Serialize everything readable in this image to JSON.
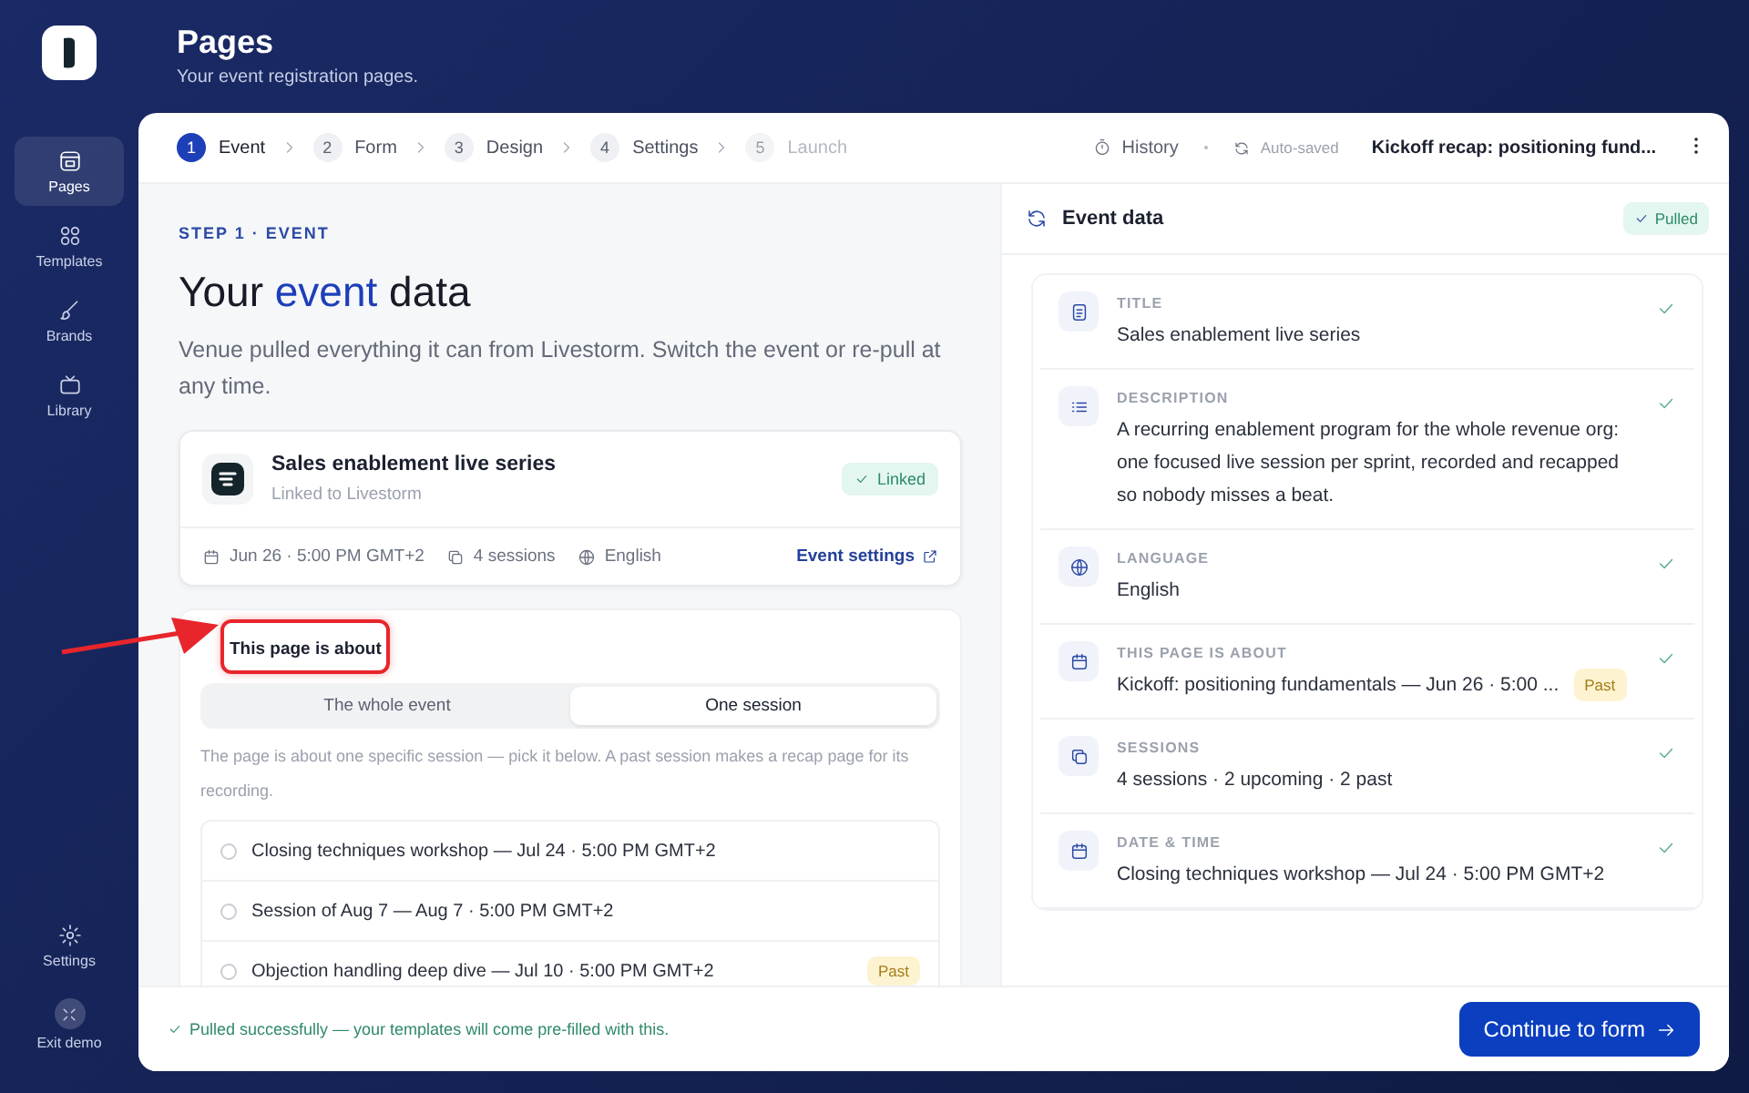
{
  "sidebar": {
    "items": [
      {
        "label": "Pages",
        "kind": "pages",
        "selected": true
      },
      {
        "label": "Templates",
        "kind": "templates",
        "selected": false
      },
      {
        "label": "Brands",
        "kind": "brands",
        "selected": false
      },
      {
        "label": "Library",
        "kind": "library",
        "selected": false
      }
    ],
    "bottom_items": [
      {
        "label": "Settings",
        "kind": "settings"
      },
      {
        "label": "Exit demo",
        "kind": "exit"
      }
    ]
  },
  "header": {
    "title": "Pages",
    "subtitle": "Your event registration pages."
  },
  "stepper": {
    "steps": [
      {
        "number": "1",
        "label": "Event",
        "selected": true,
        "disabled": false
      },
      {
        "number": "2",
        "label": "Form",
        "selected": false,
        "disabled": false
      },
      {
        "number": "3",
        "label": "Design",
        "selected": false,
        "disabled": false
      },
      {
        "number": "4",
        "label": "Settings",
        "selected": false,
        "disabled": false
      },
      {
        "number": "5",
        "label": "Launch",
        "selected": false,
        "disabled": true
      }
    ],
    "history": "History",
    "autosave": "Auto-saved",
    "page_title": "Kickoff recap: positioning fund..."
  },
  "event": {
    "step_label": "STEP 1 · EVENT",
    "heading": [
      {
        "text": "Your",
        "highlight": false
      },
      {
        "text": "event",
        "highlight": true
      },
      {
        "text": "data",
        "highlight": false
      }
    ],
    "intro": "Venue pulled everything it can from Livestorm. Switch the event or re-pull at any time.",
    "card": {
      "title": "Sales enablement live series",
      "subtitle": "Linked to Livestorm",
      "badge": "Linked",
      "meta": [
        {
          "kind": "date",
          "text": "Jun 26 · 5:00 PM GMT+2"
        },
        {
          "kind": "sessions",
          "text": "4 sessions"
        },
        {
          "kind": "language",
          "text": "English"
        }
      ],
      "link": "Event settings"
    },
    "about": {
      "label": "This page is about",
      "options": [
        {
          "label": "The whole event",
          "selected": false
        },
        {
          "label": "One session",
          "selected": true
        }
      ],
      "hint": "The page is about one specific session — pick it below. A past session makes a recap page for its recording.",
      "sessions": [
        {
          "label": "Closing techniques workshop — Jul 24 · 5:00 PM GMT+2",
          "selected": false
        },
        {
          "label": "Session of Aug 7 — Aug 7 · 5:00 PM GMT+2",
          "selected": false
        },
        {
          "label": "Objection handling deep dive — Jul 10 · 5:00 PM GMT+2",
          "selected": false,
          "badge": "Past"
        }
      ]
    }
  },
  "data_panel": {
    "title": "Event data",
    "badge": "Pulled",
    "fields": [
      {
        "kind": "title",
        "label": "TITLE",
        "value": "Sales enablement live series",
        "verified": true
      },
      {
        "kind": "description",
        "label": "DESCRIPTION",
        "value": "A recurring enablement program for the whole revenue org: one focused live session per sprint, recorded and recapped so nobody misses a beat.",
        "verified": true
      },
      {
        "kind": "language",
        "label": "LANGUAGE",
        "value": "English",
        "verified": true
      },
      {
        "kind": "about",
        "label": "THIS PAGE IS ABOUT",
        "value": "Kickoff: positioning fundamentals — Jun 26 · 5:00 ...",
        "badge": "Past",
        "verified": true
      },
      {
        "kind": "sessions",
        "label": "SESSIONS",
        "value": "4 sessions · 2 upcoming · 2 past",
        "verified": true
      },
      {
        "kind": "datetime",
        "label": "DATE & TIME",
        "value": "Closing techniques workshop — Jul 24 · 5:00 PM GMT+2",
        "verified": true
      }
    ]
  },
  "footer": {
    "message": "Pulled successfully — your templates will come pre-filled with this.",
    "button": "Continue to form"
  }
}
